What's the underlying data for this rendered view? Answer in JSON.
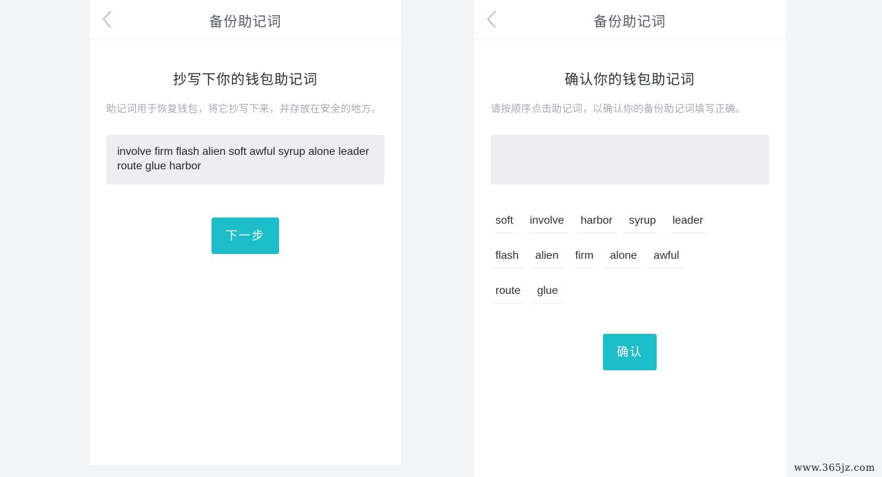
{
  "left_screen": {
    "nav_title": "备份助记词",
    "back_icon": "chevron-left-icon",
    "headline": "抄写下你的钱包助记词",
    "description": "助记词用于恢复钱包，将它抄写下来，并存放在安全的地方。",
    "mnemonic": "involve firm flash alien soft awful syrup alone leader route glue harbor",
    "next_button": "下一步"
  },
  "right_screen": {
    "nav_title": "备份助记词",
    "back_icon": "chevron-left-icon",
    "headline": "确认你的钱包助记词",
    "description": "请按顺序点击助记词，以确认你的备份助记词填写正确。",
    "selected_phrase": "",
    "word_rows": [
      [
        "soft",
        "involve",
        "harbor",
        "syrup",
        "leader"
      ],
      [
        "flash",
        "alien",
        "firm",
        "alone",
        "awful"
      ],
      [
        "route",
        "glue"
      ]
    ],
    "confirm_button": "确认"
  },
  "watermark": "www.365jz.com",
  "colors": {
    "accent": "#1cbfc9",
    "phrase_box_bg": "#eeeef0",
    "page_bg": "#f3f4f6"
  }
}
